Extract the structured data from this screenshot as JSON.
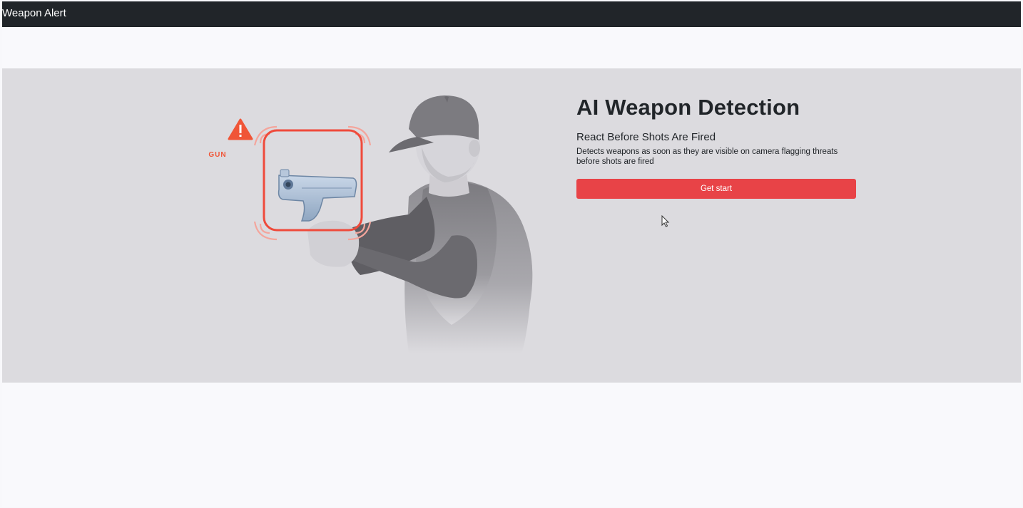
{
  "navbar": {
    "brand": "Weapon Alert"
  },
  "hero": {
    "title": "AI Weapon Detection",
    "subtitle": "React Before Shots Are Fired",
    "description": "Detects weapons as soon as they are visible on camera flagging threats before shots are fired",
    "cta_label": "Get start"
  },
  "illustration": {
    "detection_label": "GUN",
    "icons": [
      "warning-icon",
      "detection-frame",
      "pistol"
    ]
  },
  "colors": {
    "navbar_bg": "#212529",
    "hero_bg": "#dcdbdf",
    "accent": "#e84347",
    "alert": "#f05537"
  }
}
